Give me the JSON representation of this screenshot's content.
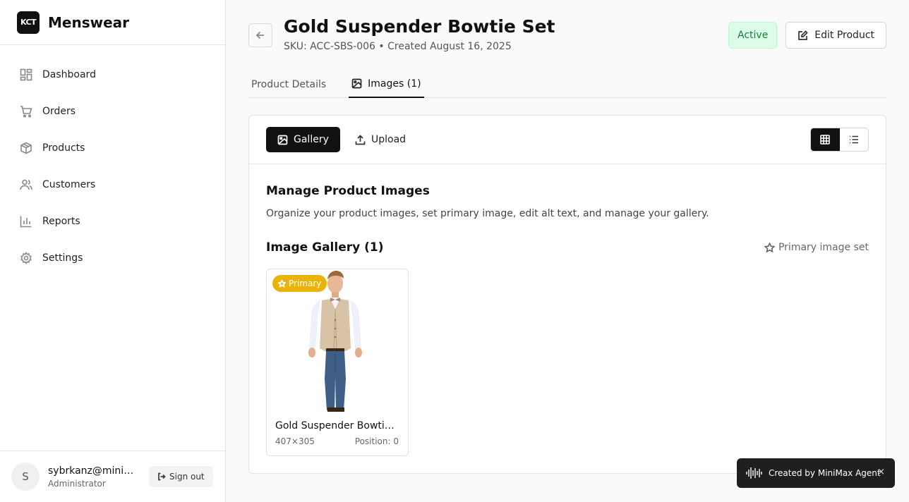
{
  "brand": {
    "logo_text": "KCT",
    "name": "Menswear"
  },
  "nav": {
    "items": [
      {
        "label": "Dashboard",
        "icon": "dashboard-icon"
      },
      {
        "label": "Orders",
        "icon": "cart-icon"
      },
      {
        "label": "Products",
        "icon": "package-icon"
      },
      {
        "label": "Customers",
        "icon": "users-icon"
      },
      {
        "label": "Reports",
        "icon": "bar-chart-icon"
      },
      {
        "label": "Settings",
        "icon": "gear-icon"
      }
    ]
  },
  "user": {
    "avatar_letter": "S",
    "email": "sybrkanz@minimax.com",
    "role": "Administrator",
    "signout_label": "Sign out"
  },
  "product": {
    "title": "Gold Suspender Bowtie Set",
    "subtitle": "SKU: ACC-SBS-006 • Created August 16, 2025",
    "status": "Active",
    "edit_label": "Edit Product"
  },
  "tabs": {
    "details": "Product Details",
    "images": "Images (1)"
  },
  "toolbar": {
    "gallery_label": "Gallery",
    "upload_label": "Upload"
  },
  "manage": {
    "title": "Manage Product Images",
    "description": "Organize your product images, set primary image, edit alt text, and manage your gallery."
  },
  "gallery": {
    "title": "Image Gallery (1)",
    "primary_set_label": "Primary image set",
    "images": [
      {
        "badge": "Primary",
        "name": "Gold Suspender Bowtie Set",
        "dims": "407×305",
        "position": "Position: 0"
      }
    ]
  },
  "toast": {
    "text": "Created by MiniMax Agent",
    "close": "×"
  },
  "colors": {
    "accent": "#111111",
    "status_bg": "#dcfce7",
    "status_text": "#15803d",
    "primary_badge": "#eab308"
  }
}
